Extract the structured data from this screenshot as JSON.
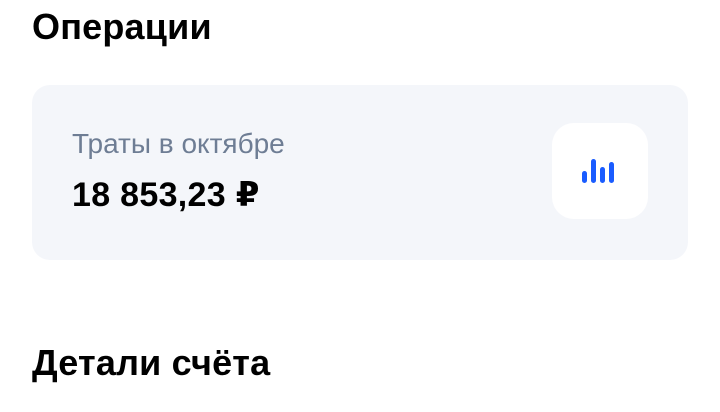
{
  "operations": {
    "title": "Операции"
  },
  "spending_card": {
    "subtitle": "Траты в октябре",
    "amount": "18 853,23 ₽",
    "icon": "bar-chart-icon",
    "accent_color": "#1a5cff"
  },
  "account_details": {
    "title": "Детали счёта"
  }
}
